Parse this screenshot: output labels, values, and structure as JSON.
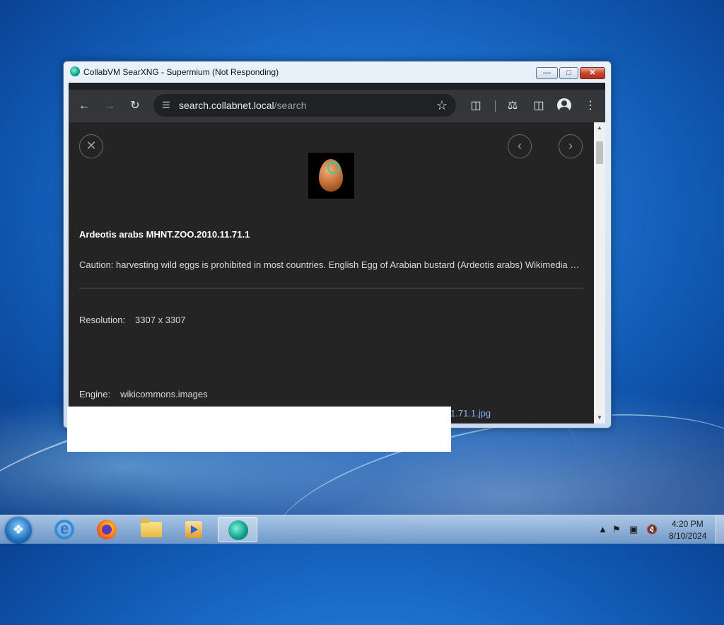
{
  "window": {
    "title": "CollabVM SearXNG - Supermium (Not Responding)",
    "controls": {
      "minimize": "—",
      "maximize": "□",
      "close": "✕"
    }
  },
  "browser": {
    "url_host": "search.collabnet.local",
    "url_path": "/search",
    "icons": [
      "back-icon",
      "forward-icon",
      "reload-icon",
      "site-info-icon",
      "bookmark-star-icon",
      "extensions-icon",
      "labs-icon",
      "side-panel-icon",
      "profile-icon",
      "menu-icon"
    ]
  },
  "viewer": {
    "close_glyph": "✕",
    "prev_glyph": "‹",
    "next_glyph": "›",
    "title": "Ardeotis arabs MHNT.ZOO.2010.11.71.1",
    "description": "Caution: harvesting wild eggs is prohibited in most countries. English Egg of Arabian bustard (Ardeotis arabs) Wikimedia …",
    "resolution_label": "Resolution:",
    "resolution_value": "3307 x 3307",
    "engine_label": "Engine:",
    "engine_value": "wikicommons.images",
    "link_fragment": "1.71.1.jpg"
  },
  "taskbar": {
    "apps": [
      "start-button",
      "internet-explorer",
      "firefox",
      "file-explorer",
      "media-player",
      "collabvm-supermium"
    ],
    "clock_time": "4:20 PM",
    "clock_date": "8/10/2024"
  },
  "colors": {
    "page_bg": "#242424",
    "toolbar_bg": "#35363a",
    "link": "#8ab4f8",
    "close_button": "#c8462f"
  }
}
